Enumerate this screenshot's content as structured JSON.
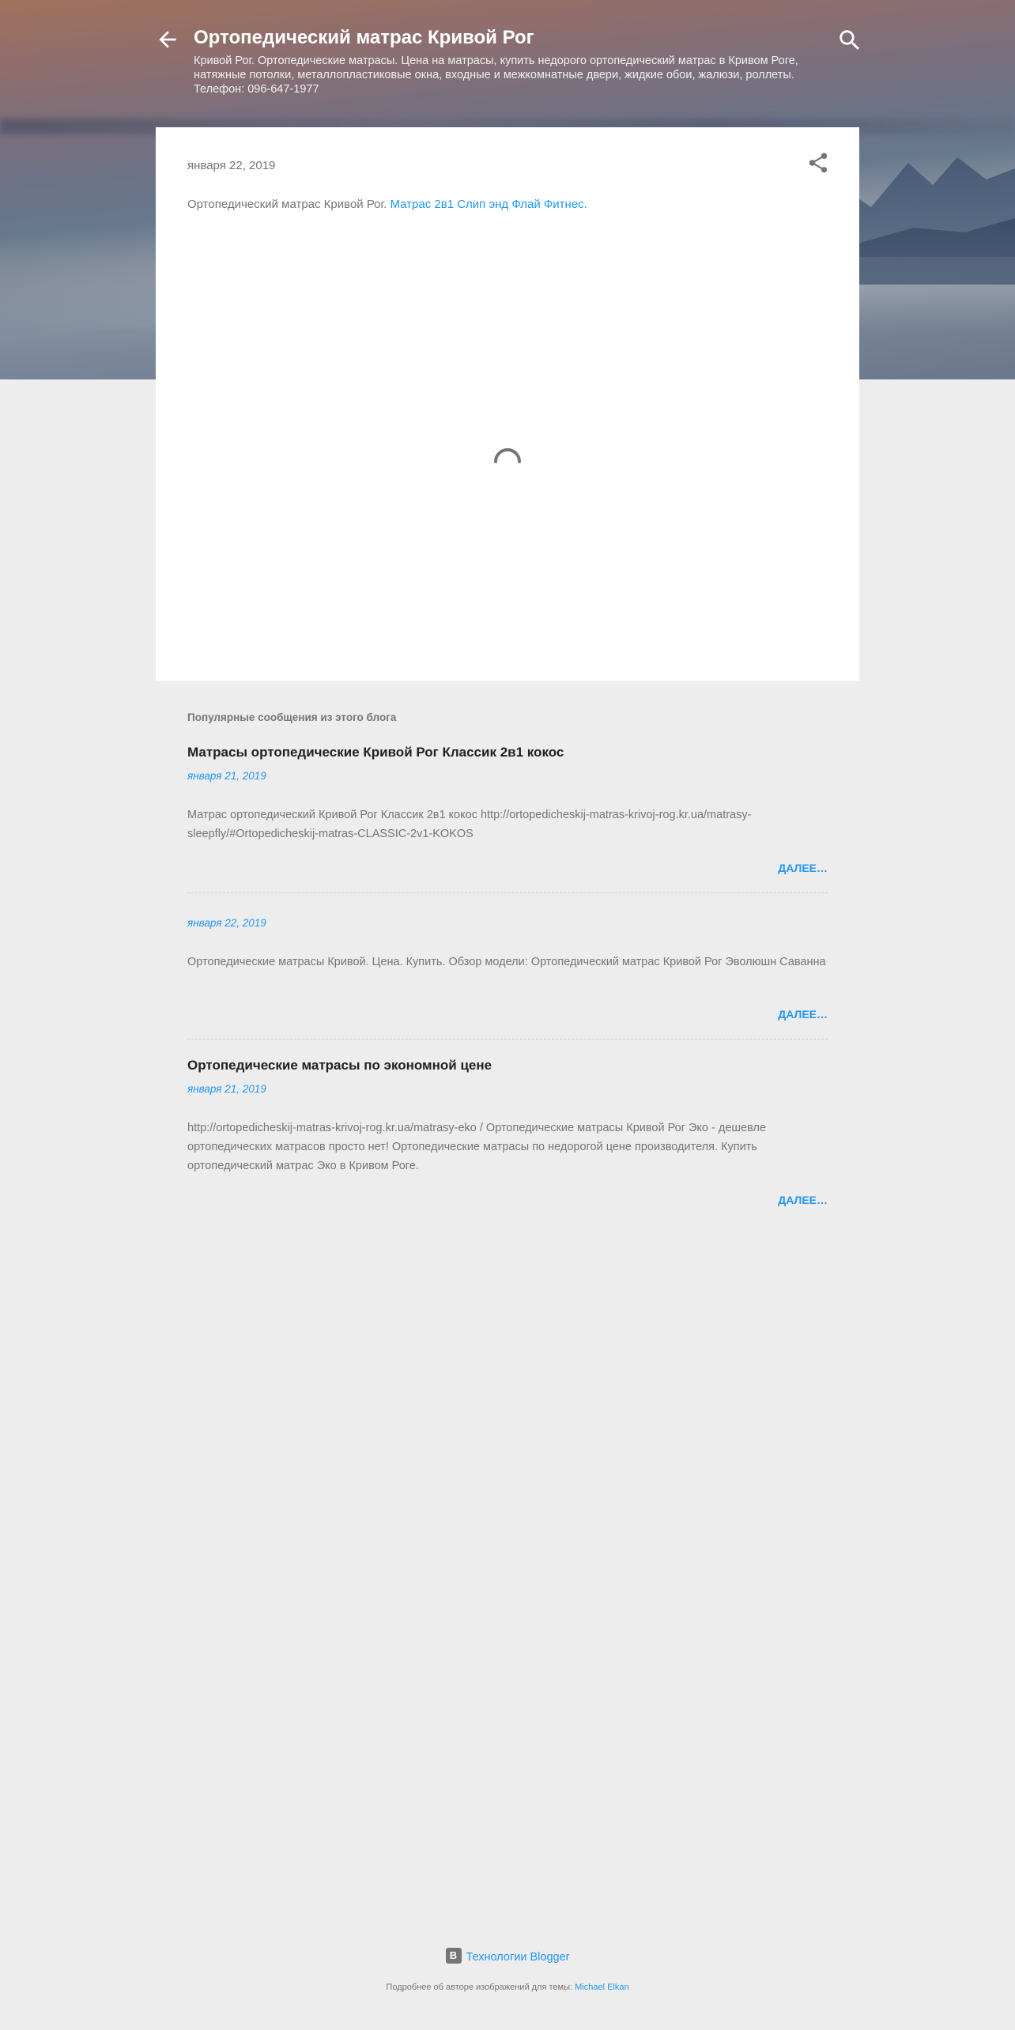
{
  "header": {
    "title": "Ортопедический матрас Кривой Рог",
    "description": "Кривой Рог. Ортопедические матрасы. Цена на матрасы, купить недорого ортопедический матрас в Кривом Роге, натяжные потолки, металлопластиковые окна, входные и межкомнатные двери, жидкие обои, жалюзи, роллеты. Телефон: 096-647-1977",
    "back_icon": "arrow-back-icon",
    "search_icon": "search-icon"
  },
  "post": {
    "date": "января 22, 2019",
    "body_text": "Ортопедический матрас Кривой Рог. ",
    "body_link": "Матрас 2в1 Слип энд Флай Фитнес.",
    "share_icon": "share-icon",
    "loading_icon": "spinner-icon"
  },
  "popular": {
    "heading": "Популярные сообщения из этого блога",
    "posts": [
      {
        "title": "Матрасы ортопедические Кривой Рог Классик 2в1 кокос",
        "date": "января 21, 2019",
        "snippet": "Матрас ортопедический Кривой Рог Классик 2в1 кокос http://ortopedicheskij-matras-krivoj-rog.kr.ua/matrasy-sleepfly/#Ortopedicheskij-matras-CLASSIC-2v1-KOKOS",
        "more": "Далее…"
      },
      {
        "title": "",
        "date": "января 22, 2019",
        "snippet": "Ортопедические матрасы Кривой. Цена. Купить. Обзор модели: Ортопедический матрас Кривой Рог Эволюшн Саванна",
        "more": "Далее…"
      },
      {
        "title": "Ортопедические матрасы по экономной цене",
        "date": "января 21, 2019",
        "snippet": "http://ortopedicheskij-matras-krivoj-rog.kr.ua/matrasy-eko / Ортопедические матрасы Кривой Рог Эко - дешевле ортопедических матрасов просто нет! Ортопедические матрасы по недорогой цене производителя. Купить ортопедический матрас Эко в Кривом Роге.",
        "more": "Далее…"
      }
    ]
  },
  "footer": {
    "blogger_label": "Технологии Blogger",
    "blogger_icon": "blogger-icon",
    "credit_text": "Подробнее об авторе изображений для темы: ",
    "credit_link": "Michael Elkan"
  },
  "colors": {
    "accent": "#2196f3",
    "background": "#ededed",
    "card": "#ffffff"
  }
}
